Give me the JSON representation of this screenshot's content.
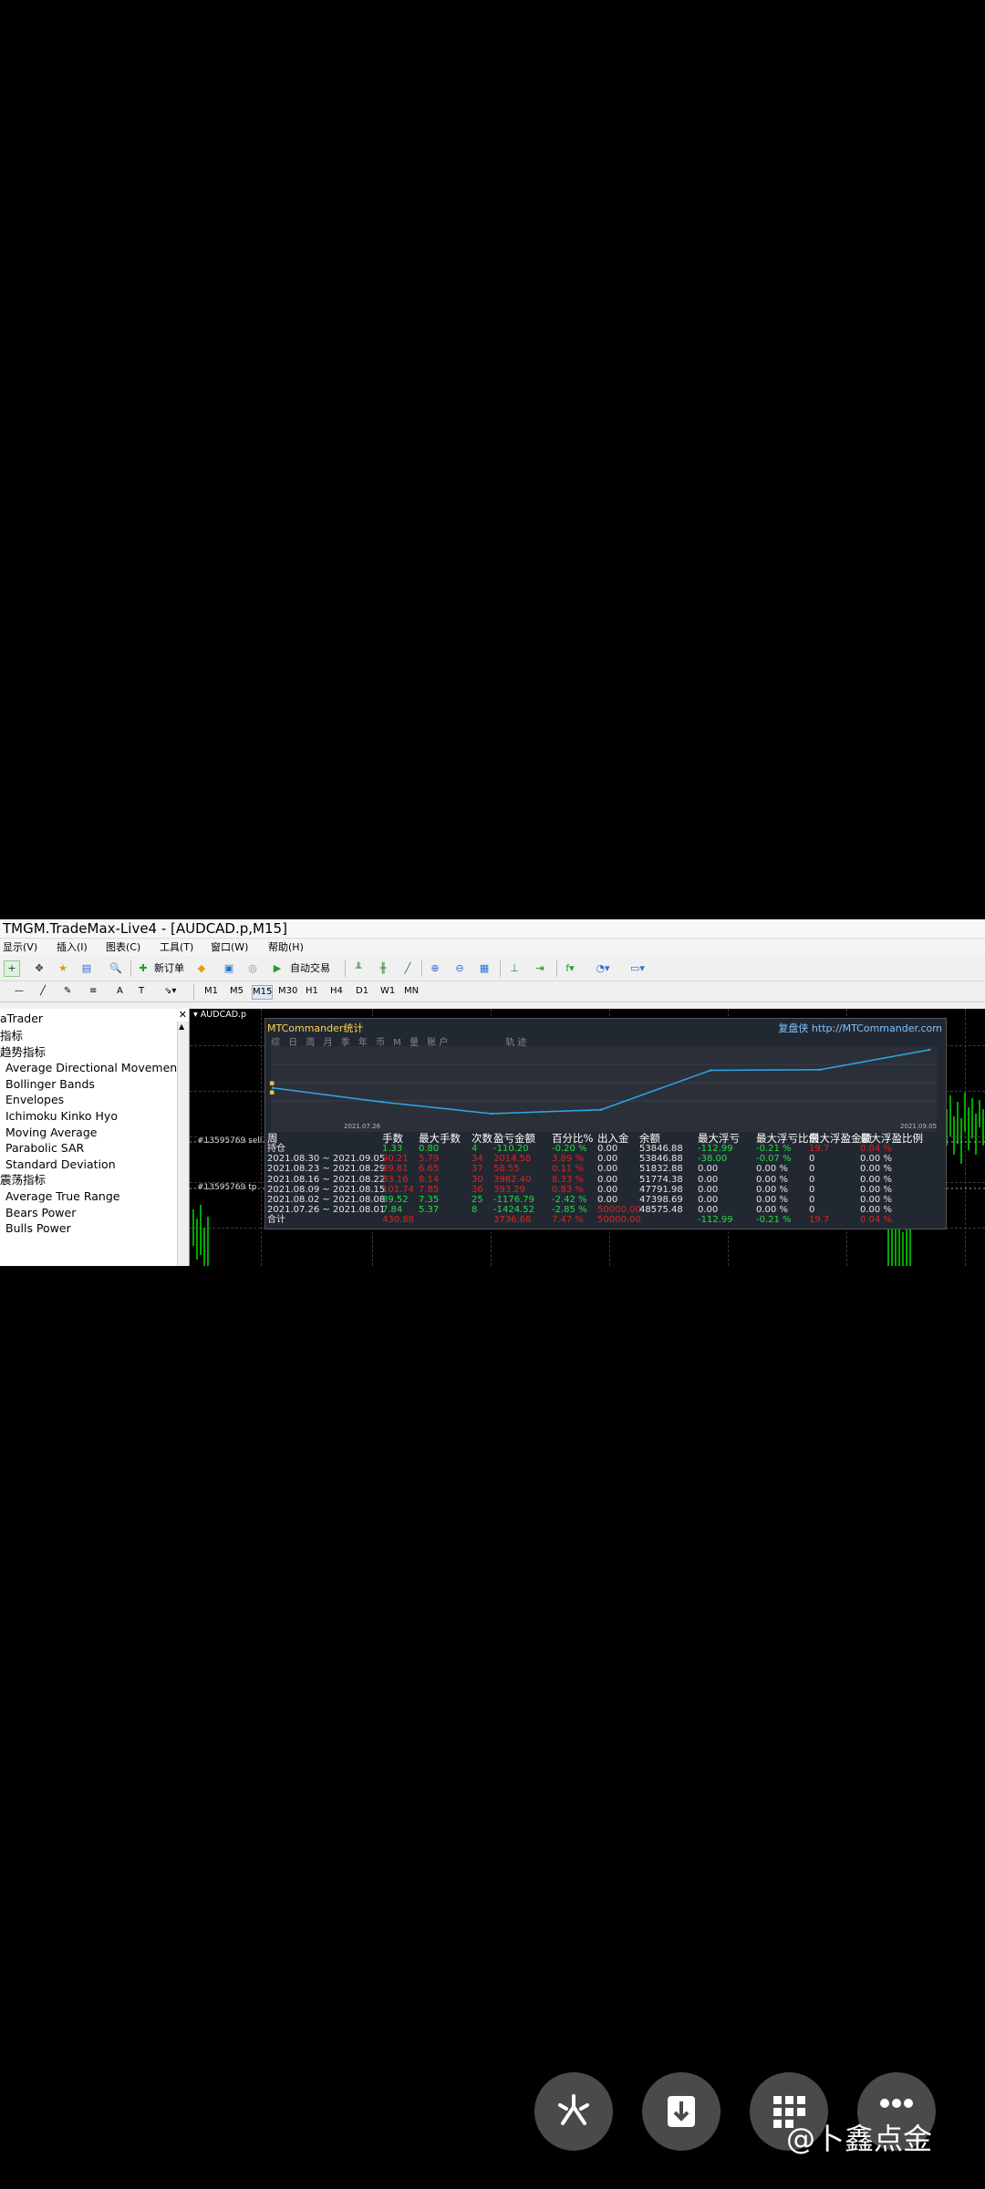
{
  "window": {
    "title": "TMGM.TradeMax-Live4 - [AUDCAD.p,M15]"
  },
  "menu": [
    "显示(V)",
    "插入(I)",
    "图表(C)",
    "工具(T)",
    "窗口(W)",
    "帮助(H)"
  ],
  "toolbar": {
    "new_order": "新订单",
    "auto_trade": "自动交易"
  },
  "timeframes": [
    "M1",
    "M5",
    "M15",
    "M30",
    "H1",
    "H4",
    "D1",
    "W1",
    "MN"
  ],
  "navigator": {
    "title": "aTrader",
    "items": [
      {
        "label": "指标",
        "indent": 0
      },
      {
        "label": "趋势指标",
        "indent": 0
      },
      {
        "label": "Average Directional Movemen",
        "indent": 1
      },
      {
        "label": "Bollinger Bands",
        "indent": 1
      },
      {
        "label": "Envelopes",
        "indent": 1
      },
      {
        "label": "Ichimoku Kinko Hyo",
        "indent": 1
      },
      {
        "label": "Moving Average",
        "indent": 1
      },
      {
        "label": "Parabolic SAR",
        "indent": 1
      },
      {
        "label": "Standard Deviation",
        "indent": 1
      },
      {
        "label": "震荡指标",
        "indent": 0
      },
      {
        "label": "Average True Range",
        "indent": 1
      },
      {
        "label": "Bears Power",
        "indent": 1
      },
      {
        "label": "Bulls Power",
        "indent": 1
      }
    ]
  },
  "chart": {
    "tab": "AUDCAD.p",
    "order_label_1": "#13595769 sell",
    "order_label_2": "#13595769 tp"
  },
  "panel": {
    "title": "MTCommander统计",
    "link_label": "复盘侠",
    "link_url": "http://MTCommander.com",
    "tabs": "综 日 周 月 季 年 币 M 量 账户",
    "tab_extra": "轨迹",
    "date_start": "2021.07.26",
    "date_end": "2021.09.05",
    "headers": [
      "周",
      "手数",
      "最大手数",
      "次数",
      "盈亏金额",
      "百分比%",
      "出入金",
      "余额",
      "最大浮亏",
      "最大浮亏比例",
      "最大浮盈金额",
      "最大浮盈比例"
    ],
    "rows": [
      {
        "c": [
          "持仓",
          "1.33",
          "0.80",
          "4",
          "-110.20",
          "-0.20 %",
          "0.00",
          "53846.88",
          "-112.99",
          "-0.21 %",
          "19.7",
          "0.04 %"
        ],
        "cls": [
          "w",
          "g",
          "g",
          "g",
          "g",
          "g",
          "w",
          "w",
          "g",
          "g",
          "r",
          "r"
        ]
      },
      {
        "c": [
          "2021.08.30 ~ 2021.09.05",
          "90.21",
          "5.79",
          "34",
          "2014.58",
          "3.89 %",
          "0.00",
          "53846.88",
          "-38.00",
          "-0.07 %",
          "0",
          "0.00 %"
        ],
        "cls": [
          "w",
          "r",
          "r",
          "r",
          "r",
          "r",
          "w",
          "w",
          "g",
          "g",
          "w",
          "w"
        ]
      },
      {
        "c": [
          "2021.08.23 ~ 2021.08.29",
          "89.81",
          "6.65",
          "37",
          "58.55",
          "0.11 %",
          "0.00",
          "51832.88",
          "0.00",
          "0.00 %",
          "0",
          "0.00 %"
        ],
        "cls": [
          "w",
          "r",
          "r",
          "r",
          "r",
          "r",
          "w",
          "w",
          "w",
          "w",
          "w",
          "w"
        ]
      },
      {
        "c": [
          "2021.08.16 ~ 2021.08.22",
          "83.16",
          "8.14",
          "30",
          "3982.40",
          "8.33 %",
          "0.00",
          "51774.38",
          "0.00",
          "0.00 %",
          "0",
          "0.00 %"
        ],
        "cls": [
          "w",
          "r",
          "r",
          "r",
          "r",
          "r",
          "w",
          "w",
          "w",
          "w",
          "w",
          "w"
        ]
      },
      {
        "c": [
          "2021.08.09 ~ 2021.08.15",
          "101.74",
          "7.85",
          "36",
          "393.29",
          "0.83 %",
          "0.00",
          "47791.98",
          "0.00",
          "0.00 %",
          "0",
          "0.00 %"
        ],
        "cls": [
          "w",
          "r",
          "r",
          "r",
          "r",
          "r",
          "w",
          "w",
          "w",
          "w",
          "w",
          "w"
        ]
      },
      {
        "c": [
          "2021.08.02 ~ 2021.08.08",
          "89.52",
          "7.35",
          "25",
          "-1176.79",
          "-2.42 %",
          "0.00",
          "47398.69",
          "0.00",
          "0.00 %",
          "0",
          "0.00 %"
        ],
        "cls": [
          "w",
          "g",
          "g",
          "g",
          "g",
          "g",
          "w",
          "w",
          "w",
          "w",
          "w",
          "w"
        ]
      },
      {
        "c": [
          "2021.07.26 ~ 2021.08.01",
          "7.84",
          "5.37",
          "8",
          "-1424.52",
          "-2.85 %",
          "50000.00",
          "48575.48",
          "0.00",
          "0.00 %",
          "0",
          "0.00 %"
        ],
        "cls": [
          "w",
          "g",
          "g",
          "g",
          "g",
          "g",
          "r",
          "w",
          "w",
          "w",
          "w",
          "w"
        ]
      },
      {
        "c": [
          "合计",
          "430.88",
          "",
          "",
          "3736.68",
          "7.47 %",
          "50000.00",
          "",
          "-112.99",
          "-0.21 %",
          "19.7",
          "0.04 %"
        ],
        "cls": [
          "w",
          "r",
          "r",
          "r",
          "r",
          "r",
          "r",
          "w",
          "g",
          "g",
          "r",
          "r"
        ]
      }
    ]
  },
  "balance_chart": {
    "type": "line",
    "x": [
      "2021.07.26",
      "2021.08.01",
      "2021.08.08",
      "2021.08.15",
      "2021.08.22",
      "2021.08.29",
      "2021.09.05"
    ],
    "values": [
      50000.0,
      48575.48,
      47398.69,
      47791.98,
      51774.38,
      51832.88,
      53846.88
    ],
    "color": "#2ea8e8"
  },
  "watermark": "@卜鑫点金",
  "fab_icons": [
    "sparkle-icon",
    "download-icon",
    "grid-icon",
    "more-icon"
  ]
}
